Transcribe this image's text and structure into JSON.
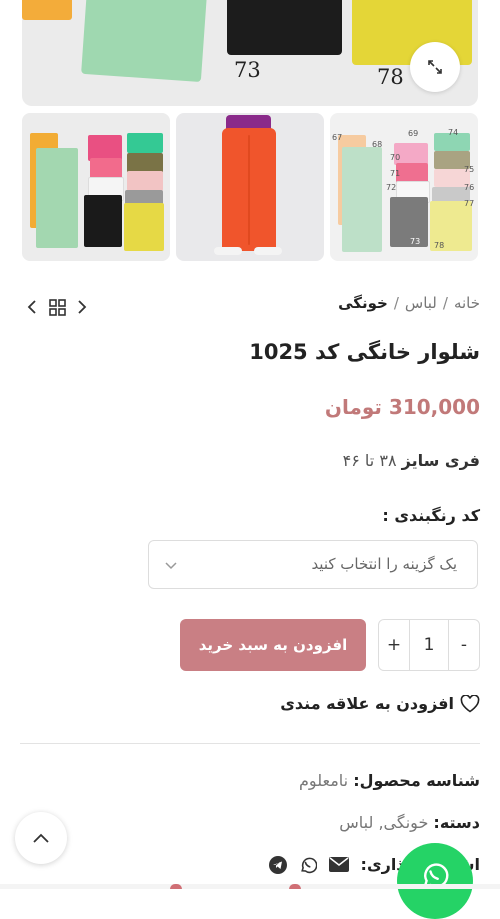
{
  "gallery": {
    "main_image_numbers": [
      "73",
      "78"
    ],
    "thumbnail_numbers": [
      "67",
      "68",
      "69",
      "70",
      "71",
      "72",
      "73",
      "74",
      "75",
      "76",
      "77",
      "78"
    ]
  },
  "breadcrumb": {
    "home": "خانه",
    "category": "لباس",
    "current": "خونگی",
    "separator": "/"
  },
  "product": {
    "title": "شلوار خانگی کد 1025",
    "price": "310,000 تومان",
    "size_label": "فری سایز",
    "size_range": "۳۸ تا ۴۶",
    "color_label": "کد رنگبندی :",
    "color_placeholder": "یک گزینه را انتخاب کنید",
    "quantity": "1",
    "minus": "-",
    "plus": "+",
    "add_to_cart": "افزودن به سبد خرید",
    "wishlist": "افزودن به علاقه مندی"
  },
  "meta": {
    "sku_label": "شناسه محصول:",
    "sku_value": "نامعلوم",
    "category_label": "دسته:",
    "category_value": "خونگی, لباس",
    "share_label": "اشتراک گذاری:"
  },
  "icons": [
    "expand-icon",
    "chevron-left-icon",
    "grid-icon",
    "chevron-right-icon",
    "chevron-down-icon",
    "heart-icon",
    "email-icon",
    "whatsapp-icon",
    "telegram-icon",
    "chevron-up-icon"
  ],
  "colors": {
    "accent": "#c97f84",
    "price": "#c17979",
    "whatsapp": "#25d366"
  }
}
